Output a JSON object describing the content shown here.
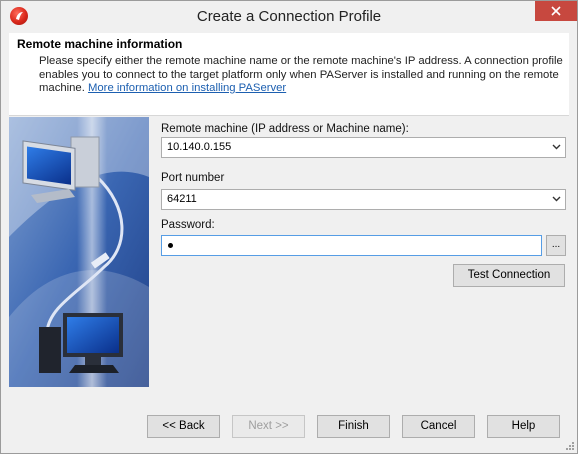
{
  "window": {
    "title": "Create a Connection Profile",
    "close_label": "close"
  },
  "header": {
    "title": "Remote machine information",
    "description": "Please specify either the remote machine name or the remote machine's IP address. A connection profile enables you to connect to the target platform only when PAServer is installed and running on the remote machine.",
    "link": "More information on installing PAServer"
  },
  "form": {
    "remote_label": "Remote machine (IP address or Machine name):",
    "remote_value": "10.140.0.155",
    "port_label": "Port number",
    "port_value": "64211",
    "password_label": "Password:",
    "browse_label": "...",
    "test_button": "Test Connection"
  },
  "footer": {
    "back": "<< Back",
    "next": "Next >>",
    "finish": "Finish",
    "cancel": "Cancel",
    "help": "Help"
  },
  "colors": {
    "close": "#c7483f",
    "accent_link": "#1c5fb0",
    "focus_border": "#569de5",
    "art_blue": "#2b5aa8"
  }
}
